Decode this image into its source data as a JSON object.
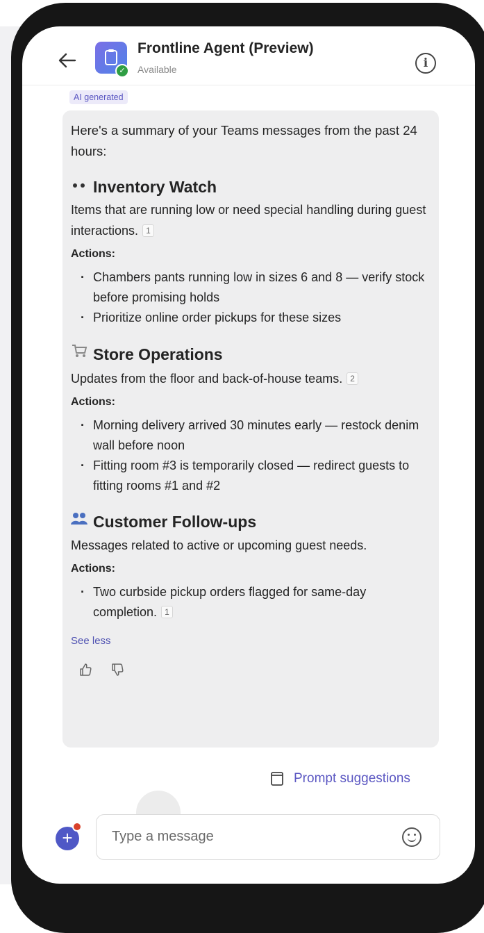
{
  "header": {
    "agent_name": "Frontline Agent (Preview)",
    "status": "Available"
  },
  "message": {
    "badge": "AI generated",
    "intro": "Here's a summary of your Teams messages from the past 24 hours:",
    "sections": [
      {
        "icon": "eyes-icon",
        "title": "Inventory Watch",
        "description": "Items that are running low or need special handling during guest interactions.",
        "citation": "1",
        "actions_label": "Actions:",
        "actions": [
          "Chambers pants running low in sizes 6 and 8 — verify stock before promising holds",
          "Prioritize online order pickups for these sizes"
        ]
      },
      {
        "icon": "cart-icon",
        "title": "Store Operations",
        "description": "Updates from the floor and back-of-house teams.",
        "citation": "2",
        "actions_label": "Actions:",
        "actions": [
          "Morning delivery arrived 30 minutes early — restock denim wall before noon",
          "Fitting room #3 is temporarily closed — redirect guests to fitting rooms #1 and #2"
        ]
      },
      {
        "icon": "people-icon",
        "title": "Customer Follow-ups",
        "description": "Messages related to active or upcoming guest needs.",
        "actions_label": "Actions:",
        "actions": [
          "Two curbside pickup orders flagged for same-day completion."
        ],
        "action_citation": "1"
      }
    ],
    "see_less": "See less"
  },
  "prompt_suggestions": "Prompt suggestions",
  "composer": {
    "placeholder": "Type a message"
  },
  "colors": {
    "accent": "#5b57c2",
    "bubble": "#eeeeef",
    "frame": "#161616"
  }
}
